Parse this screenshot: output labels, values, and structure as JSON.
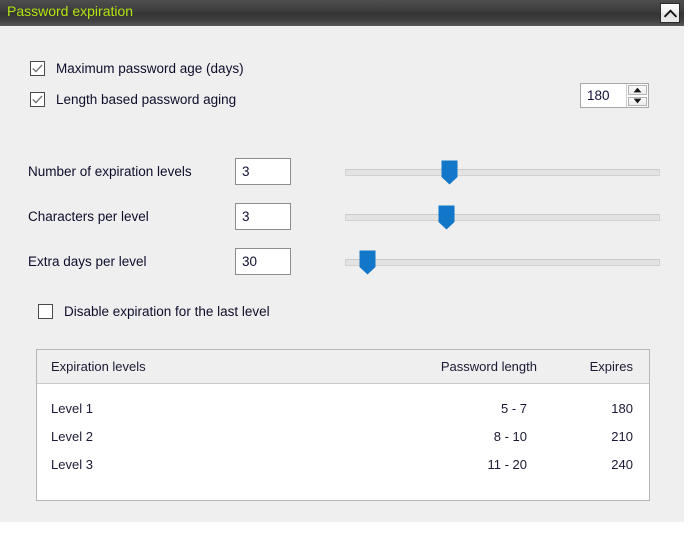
{
  "panel": {
    "title": "Password expiration",
    "collapse_icon": "chevron-up-icon",
    "title_color": "#b3e510",
    "titlebar_color": "#3d3d3d"
  },
  "checkboxes": [
    {
      "label": "Maximum password age (days)",
      "checked": true
    },
    {
      "label": "Length based password aging",
      "checked": true
    },
    {
      "label": "Disable expiration for the last level",
      "checked": false
    }
  ],
  "spinner": {
    "value": "180",
    "up_icon": "triangle-up-icon",
    "down_icon": "triangle-down-icon"
  },
  "sliders": [
    {
      "label": "Number of expiration levels",
      "value": "3",
      "percent": 35
    },
    {
      "label": "Characters per level",
      "value": "3",
      "percent": 34
    },
    {
      "label": "Extra days per level",
      "value": "30",
      "percent": 7
    }
  ],
  "table": {
    "headers": [
      "Expiration levels",
      "Password length",
      "Expires"
    ],
    "rows": [
      {
        "level": "Level 1",
        "length": "5 -  7",
        "expires": "180"
      },
      {
        "level": "Level 2",
        "length": "8 - 10",
        "expires": "210"
      },
      {
        "level": "Level 3",
        "length": "11 - 20",
        "expires": "240"
      }
    ]
  },
  "accent_color": "#1277c8"
}
